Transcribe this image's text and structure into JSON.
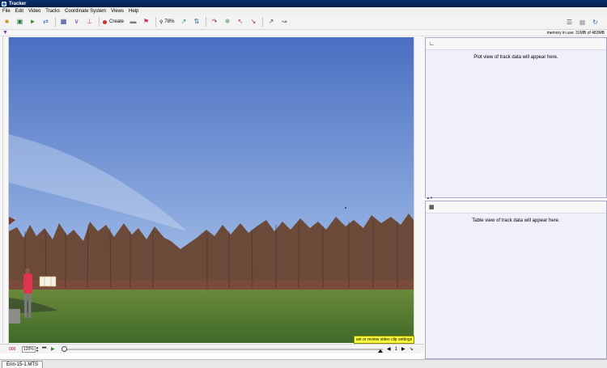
{
  "app": {
    "title": "Tracker"
  },
  "menu": [
    "File",
    "Edit",
    "Video",
    "Tracks",
    "Coordinate System",
    "Views",
    "Help"
  ],
  "toolbar": {
    "create_label": "Create",
    "zoom_label": "78%",
    "buttons_left": [
      "open-file-icon",
      "save-icon",
      "open-video-icon",
      "export-icon",
      "clip-settings-icon",
      "calibration-icon",
      "axes-icon"
    ],
    "buttons_right": [
      "ruler-icon",
      "tape-icon",
      "point-mass-icon",
      "center-of-mass-icon",
      "vector-icon",
      "vector-sum-icon",
      "line-profile-icon",
      "rgb-region-icon",
      "analytic-icon",
      "dynamic-icon"
    ]
  },
  "status": {
    "memory": "memory in use: 31MB of 483MB"
  },
  "video": {
    "colors": {
      "sky_top": "#4a6fc1",
      "sky_bottom": "#bcd4f0",
      "grass": "#4f7a2f",
      "trees": "#5a3a2a",
      "person": "#e0344e"
    }
  },
  "clip_hint": "set or review video clip settings",
  "player": {
    "counter": "000",
    "zoom": "120%",
    "frame": "1"
  },
  "panels": {
    "plot_message": "Plot view of track data will appear here.",
    "table_message": "Table view of track data will appear here."
  },
  "file_tab": "Erin-15-1.MTS"
}
